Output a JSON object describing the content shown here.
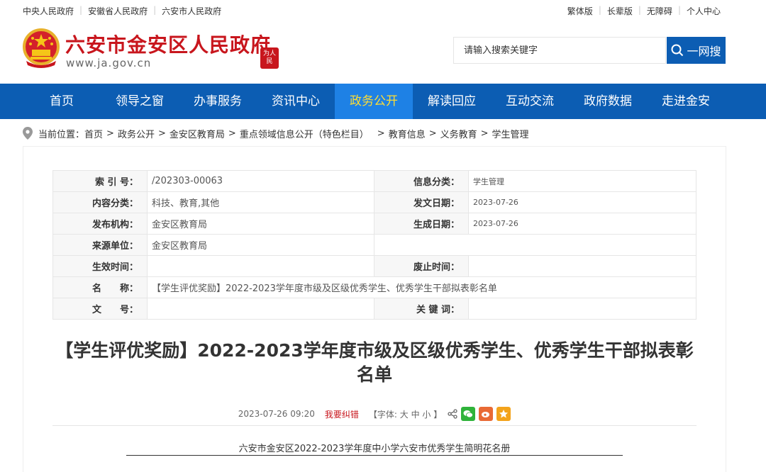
{
  "topbar": {
    "left_links": [
      "中央人民政府",
      "安徽省人民政府",
      "六安市人民政府"
    ],
    "right_links": [
      "繁体版",
      "长辈版",
      "无障碍",
      "个人中心"
    ]
  },
  "header": {
    "site_title": "六安市金安区人民政府",
    "domain": "www.ja.gov.cn",
    "seal_text_1": "为人",
    "seal_text_2": "民",
    "search_placeholder": "请输入搜索关键字",
    "search_button": "一网搜"
  },
  "nav": {
    "items": [
      "首页",
      "领导之窗",
      "办事服务",
      "资讯中心",
      "政务公开",
      "解读回应",
      "互动交流",
      "政府数据",
      "走进金安"
    ],
    "active_index": 4
  },
  "breadcrumb": {
    "label": "当前位置：",
    "items": [
      "首页",
      "政务公开",
      "金安区教育局",
      "重点领域信息公开（特色栏目）",
      "教育信息",
      "义务教育",
      "学生管理"
    ]
  },
  "meta": {
    "index_no_label": "索 引 号：",
    "index_no": "/202303-00063",
    "info_class_label": "信息分类：",
    "info_class": "学生管理",
    "content_class_label": "内容分类：",
    "content_class": "科技、教育,其他",
    "pub_date_label": "发文日期：",
    "pub_date": "2023-07-26",
    "publisher_label": "发布机构：",
    "publisher": "金安区教育局",
    "gen_date_label": "生成日期：",
    "gen_date": "2023-07-26",
    "source_label": "来源单位：",
    "source": "金安区教育局",
    "effective_label": "生效时间：",
    "effective": "",
    "expire_label": "废止时间：",
    "expire": "",
    "name_label": "名　　称：",
    "name": "【学生评优奖励】2022-2023学年度市级及区级优秀学生、优秀学生干部拟表彰名单",
    "doc_no_label": "文　　号：",
    "doc_no": "",
    "keywords_label": "关 键 词：",
    "keywords": ""
  },
  "article": {
    "title": "【学生评优奖励】2022-2023学年度市级及区级优秀学生、优秀学生干部拟表彰名单",
    "datetime": "2023-07-26 09:20",
    "report_error": "我要纠错",
    "font_label": "【字体:",
    "font_sizes": [
      "大",
      "中",
      "小"
    ],
    "font_close": "】",
    "table_caption": "六安市金安区2022-2023学年度中小学六安市优秀学生简明花名册"
  },
  "colors": {
    "brand_red": "#c8161d",
    "nav_blue": "#0c5db3",
    "nav_active": "#1e81e5",
    "nav_active_text": "#ffdd33"
  }
}
